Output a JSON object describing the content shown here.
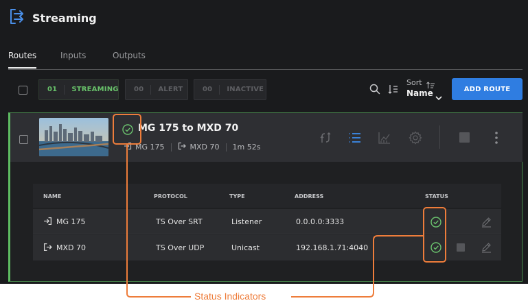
{
  "app": {
    "title": "Streaming"
  },
  "tabs": [
    {
      "label": "Routes",
      "active": true
    },
    {
      "label": "Inputs",
      "active": false
    },
    {
      "label": "Outputs",
      "active": false
    }
  ],
  "filters": [
    {
      "count": "01",
      "label": "STREAMING",
      "color": "#68c16a"
    },
    {
      "count": "00",
      "label": "ALERT",
      "color": "#5e5f63"
    },
    {
      "count": "00",
      "label": "INACTIVE",
      "color": "#5e5f63"
    }
  ],
  "toolbar": {
    "sort_label": "Sort",
    "sort_value": "Name",
    "add_route_label": "ADD ROUTE"
  },
  "route": {
    "name": "MG 175 to MXD 70",
    "status": "ok",
    "input": "MG 175",
    "output": "MXD 70",
    "duration": "1m 52s",
    "table": {
      "headers": [
        "NAME",
        "PROTOCOL",
        "TYPE",
        "ADDRESS",
        "STATUS"
      ],
      "rows": [
        {
          "direction": "input",
          "name": "MG 175",
          "protocol": "TS Over SRT",
          "type": "Listener",
          "address": "0.0.0.0:3333",
          "status": "ok"
        },
        {
          "direction": "output",
          "name": "MXD 70",
          "protocol": "TS Over UDP",
          "type": "Unicast",
          "address": "192.168.1.71:4040",
          "status": "ok"
        }
      ]
    }
  },
  "annotation": {
    "label": "Status Indicators"
  },
  "colors": {
    "background": "#1a1b1d",
    "accent_blue": "#2f7de1",
    "streaming_green": "#68c16a",
    "callout_orange": "#ee7d3b"
  }
}
